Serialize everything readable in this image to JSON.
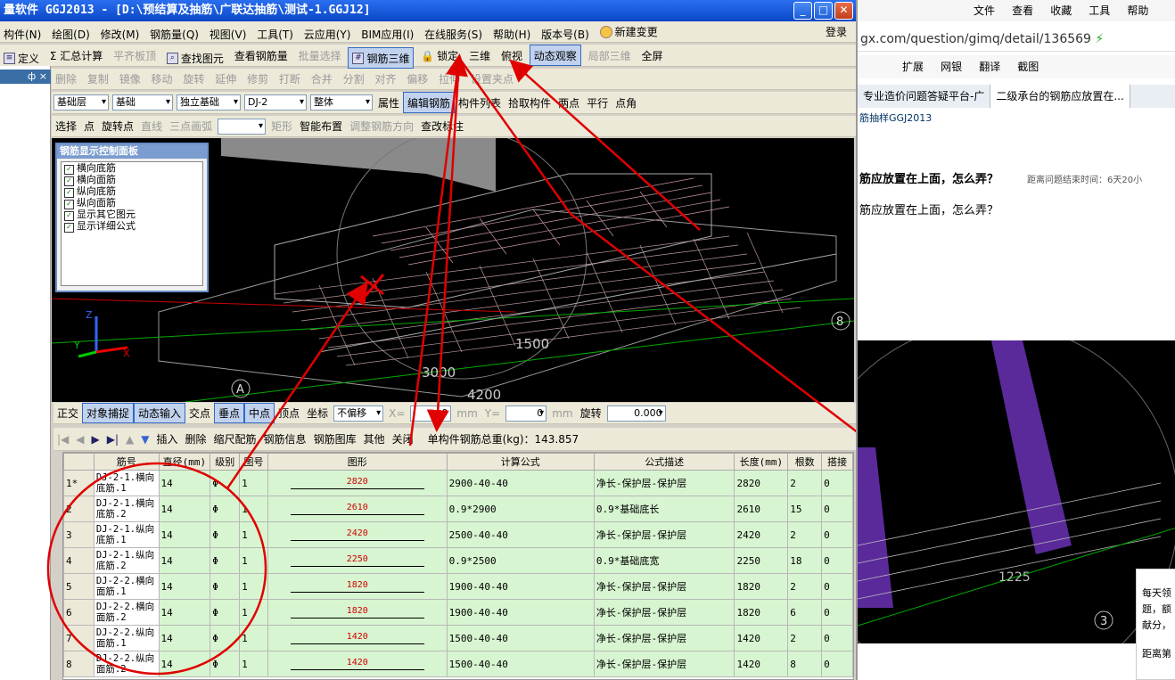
{
  "app": {
    "title": "量软件 GGJ2013 - [D:\\预结算及抽筋\\广联达抽筋\\测试-1.GGJ12]",
    "min": "_",
    "max": "□",
    "close": "✕",
    "menu": [
      "构件(N)",
      "绘图(D)",
      "修改(M)",
      "钢筋量(Q)",
      "视图(V)",
      "工具(T)",
      "云应用(Y)",
      "BIM应用(I)",
      "在线服务(S)",
      "帮助(H)",
      "版本号(B)",
      "新建变更"
    ],
    "login": "登录",
    "toolbar1": [
      "定义",
      "Σ 汇总计算",
      "平齐板顶",
      "查找图元",
      "查看钢筋量",
      "批量选择",
      "钢筋三维",
      "锁定",
      "三维",
      "俯视",
      "动态观察",
      "局部三维",
      "全屏"
    ],
    "toolbar2": [
      "删除",
      "复制",
      "镜像",
      "移动",
      "旋转",
      "延伸",
      "修剪",
      "打断",
      "合并",
      "分割",
      "对齐",
      "偏移",
      "拉伸",
      "设置夹点"
    ],
    "toolbar3": {
      "dd1": "基础层",
      "dd2": "基础",
      "dd3": "独立基础",
      "dd4": "DJ-2",
      "dd5": "整体",
      "b1": "属性",
      "b2": "编辑钢筋",
      "b3": "构件列表",
      "b4": "拾取构件",
      "b5": "两点",
      "b6": "平行",
      "b7": "点角"
    },
    "toolbar4": [
      "选择",
      "点",
      "旋转点",
      "直线",
      "三点画弧",
      "矩形",
      "智能布置",
      "调整钢筋方向",
      "查改标注"
    ],
    "panel_x": "×",
    "panel_pin": "ф",
    "ctrl_panel": {
      "title": "钢筋显示控制面板",
      "items": [
        "横向底筋",
        "横向面筋",
        "纵向底筋",
        "纵向面筋",
        "显示其它图元",
        "显示详细公式"
      ]
    },
    "view_labels": {
      "d1": "1500",
      "d2": "3000",
      "d3": "4200",
      "axisA": "A",
      "axis8": "8",
      "z": "Z",
      "y": "Y",
      "x": "X"
    },
    "snapbar": {
      "items": [
        "正交",
        "对象捕捉",
        "动态输入",
        "交点",
        "垂点",
        "中点",
        "顶点",
        "坐标"
      ],
      "offset": "不偏移",
      "x_label": "X=",
      "x_val": "0",
      "x_unit": "mm",
      "y_label": "Y=",
      "y_val": "0",
      "y_unit": "mm",
      "rot_label": "旋转",
      "rot_val": "0.000"
    },
    "gridbar": {
      "items": [
        "插入",
        "删除",
        "缩尺配筋",
        "钢筋信息",
        "钢筋图库",
        "其他",
        "关闭"
      ],
      "total": "单构件钢筋总重(kg)：143.857"
    },
    "table": {
      "headers": [
        "筋号",
        "直径(mm)",
        "级别",
        "图号",
        "图形",
        "计算公式",
        "公式描述",
        "长度(mm)",
        "根数",
        "搭接"
      ],
      "rows": [
        {
          "rn": "1*",
          "name": "DJ-2-1.横向底筋.1",
          "dia": "14",
          "grade": "Φ",
          "fig": "1",
          "shape": "2820",
          "formula": "2900-40-40",
          "desc": "净长-保护层-保护层",
          "len": "2820",
          "count": "2",
          "lap": "0"
        },
        {
          "rn": "2",
          "name": "DJ-2-1.横向底筋.2",
          "dia": "14",
          "grade": "Φ",
          "fig": "1",
          "shape": "2610",
          "formula": "0.9*2900",
          "desc": "0.9*基础底长",
          "len": "2610",
          "count": "15",
          "lap": "0"
        },
        {
          "rn": "3",
          "name": "DJ-2-1.纵向底筋.1",
          "dia": "14",
          "grade": "Φ",
          "fig": "1",
          "shape": "2420",
          "formula": "2500-40-40",
          "desc": "净长-保护层-保护层",
          "len": "2420",
          "count": "2",
          "lap": "0"
        },
        {
          "rn": "4",
          "name": "DJ-2-1.纵向底筋.2",
          "dia": "14",
          "grade": "Φ",
          "fig": "1",
          "shape": "2250",
          "formula": "0.9*2500",
          "desc": "0.9*基础底宽",
          "len": "2250",
          "count": "18",
          "lap": "0"
        },
        {
          "rn": "5",
          "name": "DJ-2-2.横向面筋.1",
          "dia": "14",
          "grade": "Φ",
          "fig": "1",
          "shape": "1820",
          "formula": "1900-40-40",
          "desc": "净长-保护层-保护层",
          "len": "1820",
          "count": "2",
          "lap": "0"
        },
        {
          "rn": "6",
          "name": "DJ-2-2.横向面筋.2",
          "dia": "14",
          "grade": "Φ",
          "fig": "1",
          "shape": "1820",
          "formula": "1900-40-40",
          "desc": "净长-保护层-保护层",
          "len": "1820",
          "count": "6",
          "lap": "0"
        },
        {
          "rn": "7",
          "name": "DJ-2-2.纵向面筋.1",
          "dia": "14",
          "grade": "Φ",
          "fig": "1",
          "shape": "1420",
          "formula": "1500-40-40",
          "desc": "净长-保护层-保护层",
          "len": "1420",
          "count": "2",
          "lap": "0"
        },
        {
          "rn": "8",
          "name": "DJ-2-2.纵向面筋.2",
          "dia": "14",
          "grade": "Φ",
          "fig": "1",
          "shape": "1420",
          "formula": "1500-40-40",
          "desc": "净长-保护层-保护层",
          "len": "1420",
          "count": "8",
          "lap": "0"
        }
      ]
    }
  },
  "browser": {
    "menu": [
      "文件",
      "查看",
      "收藏",
      "工具",
      "帮助"
    ],
    "url": "gx.com/question/gimq/detail/136569",
    "tools": [
      "扩展",
      "网银",
      "翻译",
      "截图"
    ],
    "tabs": [
      "专业造价问题答疑平台-广",
      "二级承台的钢筋应放置在..."
    ],
    "breadcrumb": "筋抽样GGJ2013",
    "question_title": "筋应放置在上面，怎么弄？",
    "deadline": "距离问题结束时间：6天20小",
    "question_body": "筋应放置在上面，怎么弄？",
    "img_label": "1225",
    "img_axis": "3",
    "popup_lines": [
      "每天领",
      "题，额",
      "献分，"
    ],
    "popup_footer": "距离第"
  },
  "colors": {
    "annotation": "#e00000",
    "grid_row": "#d7f5d0",
    "title_blue": "#0a47c7"
  }
}
